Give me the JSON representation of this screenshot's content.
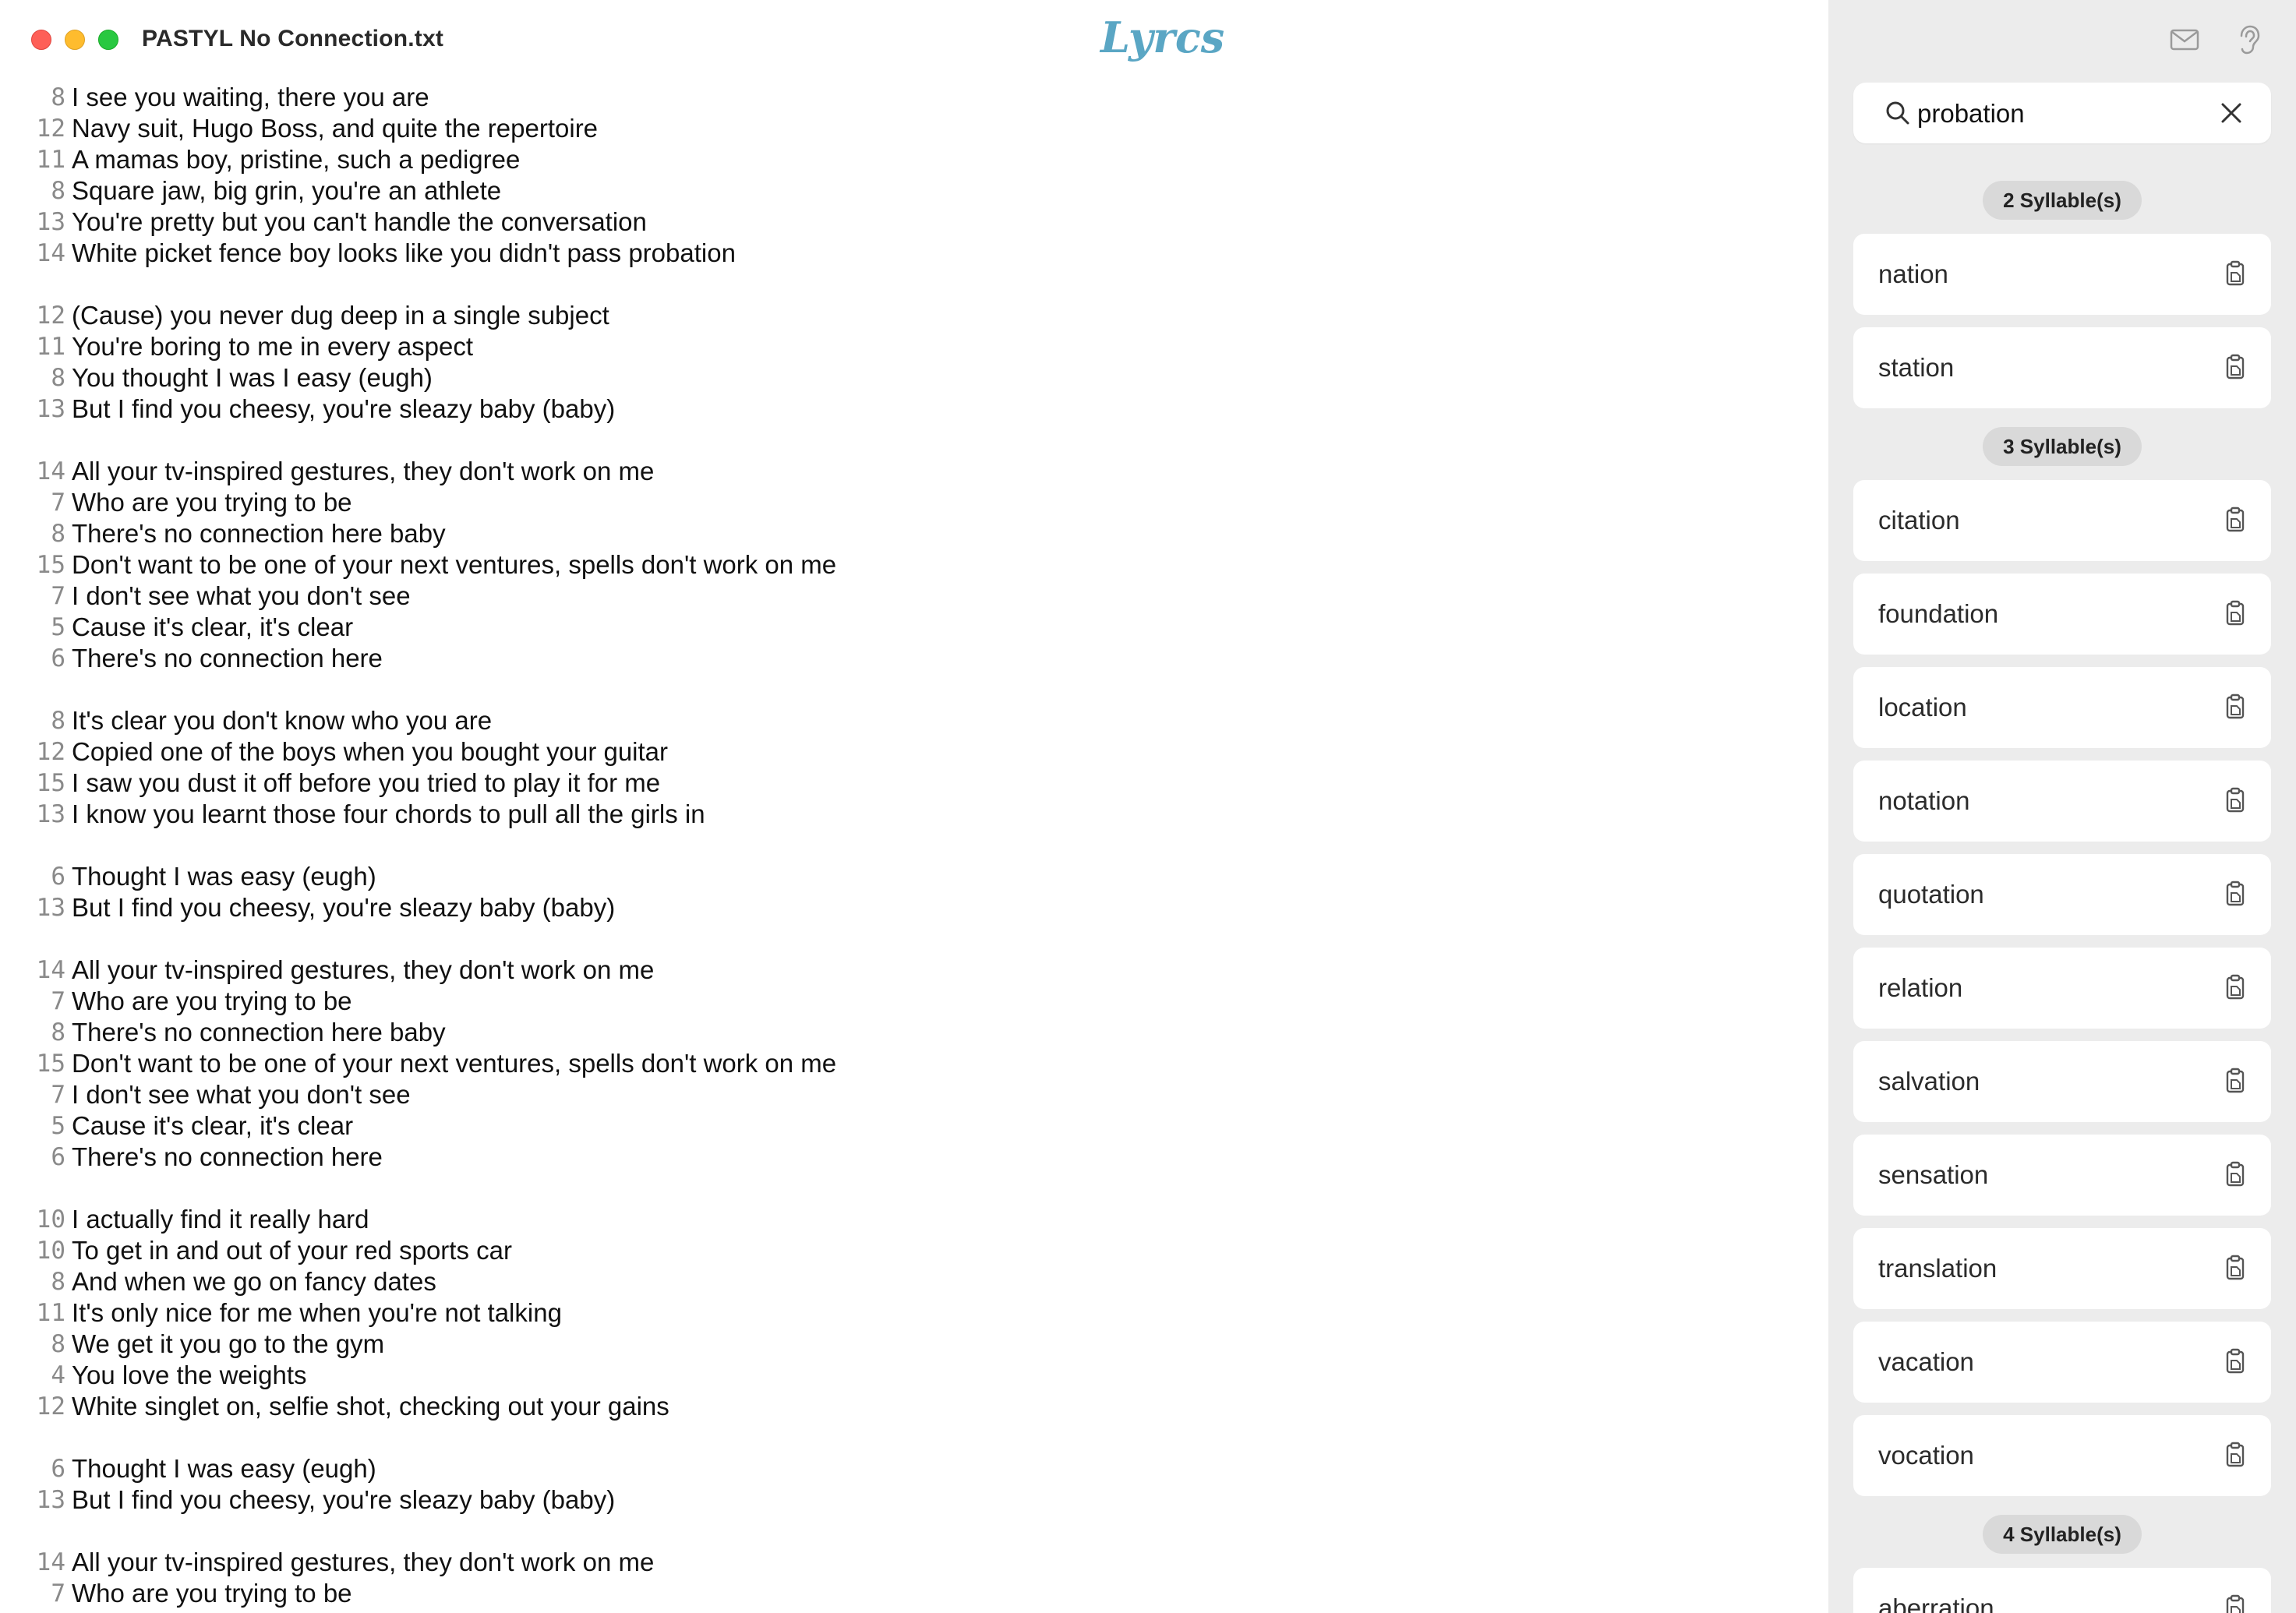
{
  "window": {
    "title": "PASTYL No Connection.txt",
    "app_name": "Lyrcs"
  },
  "lyrics": [
    {
      "n": "8",
      "t": "I see you waiting, there you are"
    },
    {
      "n": "12",
      "t": "Navy suit, Hugo Boss, and quite the repertoire"
    },
    {
      "n": "11",
      "t": "A mamas boy, pristine, such a pedigree"
    },
    {
      "n": "8",
      "t": "Square jaw, big grin, you're an athlete"
    },
    {
      "n": "13",
      "t": "You're pretty but you can't handle the conversation"
    },
    {
      "n": "14",
      "t": "White picket fence boy looks like you didn't pass probation"
    },
    {
      "n": "",
      "t": ""
    },
    {
      "n": "12",
      "t": "(Cause) you never dug deep in a single subject"
    },
    {
      "n": "11",
      "t": "You're boring to me in every aspect"
    },
    {
      "n": "8",
      "t": "You thought I was I easy (eugh)"
    },
    {
      "n": "13",
      "t": "But I find you cheesy, you're sleazy baby (baby)"
    },
    {
      "n": "",
      "t": ""
    },
    {
      "n": "14",
      "t": "All your tv-inspired gestures, they don't work on me"
    },
    {
      "n": "7",
      "t": "Who are you trying to be"
    },
    {
      "n": "8",
      "t": "There's no connection here baby"
    },
    {
      "n": "15",
      "t": "Don't want to be one of your next ventures, spells don't work on me"
    },
    {
      "n": "7",
      "t": "I don't see what you don't see"
    },
    {
      "n": "5",
      "t": "Cause it's clear, it's clear"
    },
    {
      "n": "6",
      "t": "There's no connection here"
    },
    {
      "n": "",
      "t": ""
    },
    {
      "n": "8",
      "t": "It's clear you don't know who you are"
    },
    {
      "n": "12",
      "t": "Copied one of the boys when you bought your guitar"
    },
    {
      "n": "15",
      "t": "I saw you dust it off before you tried to play it for me"
    },
    {
      "n": "13",
      "t": "I know you learnt those four chords to pull all the girls in"
    },
    {
      "n": "",
      "t": ""
    },
    {
      "n": "6",
      "t": "Thought I was easy (eugh)"
    },
    {
      "n": "13",
      "t": "But I find you cheesy, you're sleazy baby (baby)"
    },
    {
      "n": "",
      "t": ""
    },
    {
      "n": "14",
      "t": "All your tv-inspired gestures, they don't work on me"
    },
    {
      "n": "7",
      "t": "Who are you trying to be"
    },
    {
      "n": "8",
      "t": "There's no connection here baby"
    },
    {
      "n": "15",
      "t": "Don't want to be one of your next ventures, spells don't work on me"
    },
    {
      "n": "7",
      "t": "I don't see what you don't see"
    },
    {
      "n": "5",
      "t": "Cause it's clear, it's clear"
    },
    {
      "n": "6",
      "t": "There's no connection here"
    },
    {
      "n": "",
      "t": ""
    },
    {
      "n": "10",
      "t": "I actually find it really hard"
    },
    {
      "n": "10",
      "t": "To get in and out of your red sports car"
    },
    {
      "n": "8",
      "t": "And when we go on fancy dates"
    },
    {
      "n": "11",
      "t": "It's only nice for me when you're not talking"
    },
    {
      "n": "8",
      "t": "We get it you go to the gym"
    },
    {
      "n": "4",
      "t": "You love the weights"
    },
    {
      "n": "12",
      "t": "White singlet on, selfie shot, checking out your gains"
    },
    {
      "n": "",
      "t": ""
    },
    {
      "n": "6",
      "t": "Thought I was easy (eugh)"
    },
    {
      "n": "13",
      "t": "But I find you cheesy, you're sleazy baby (baby)"
    },
    {
      "n": "",
      "t": ""
    },
    {
      "n": "14",
      "t": "All your tv-inspired gestures, they don't work on me"
    },
    {
      "n": "7",
      "t": "Who are you trying to be"
    }
  ],
  "sidebar": {
    "icons": {
      "mail": "mail-icon",
      "ear": "ear-icon",
      "search": "search-icon",
      "clear": "close-icon",
      "copy": "copy-icon"
    },
    "search": {
      "value": "probation",
      "placeholder": ""
    },
    "groups": [
      {
        "label": "2 Syllable(s)",
        "words": [
          "nation",
          "station"
        ]
      },
      {
        "label": "3 Syllable(s)",
        "words": [
          "citation",
          "foundation",
          "location",
          "notation",
          "quotation",
          "relation",
          "salvation",
          "sensation",
          "translation",
          "vacation",
          "vocation"
        ]
      },
      {
        "label": "4 Syllable(s)",
        "words": [
          "aberration"
        ]
      }
    ]
  }
}
